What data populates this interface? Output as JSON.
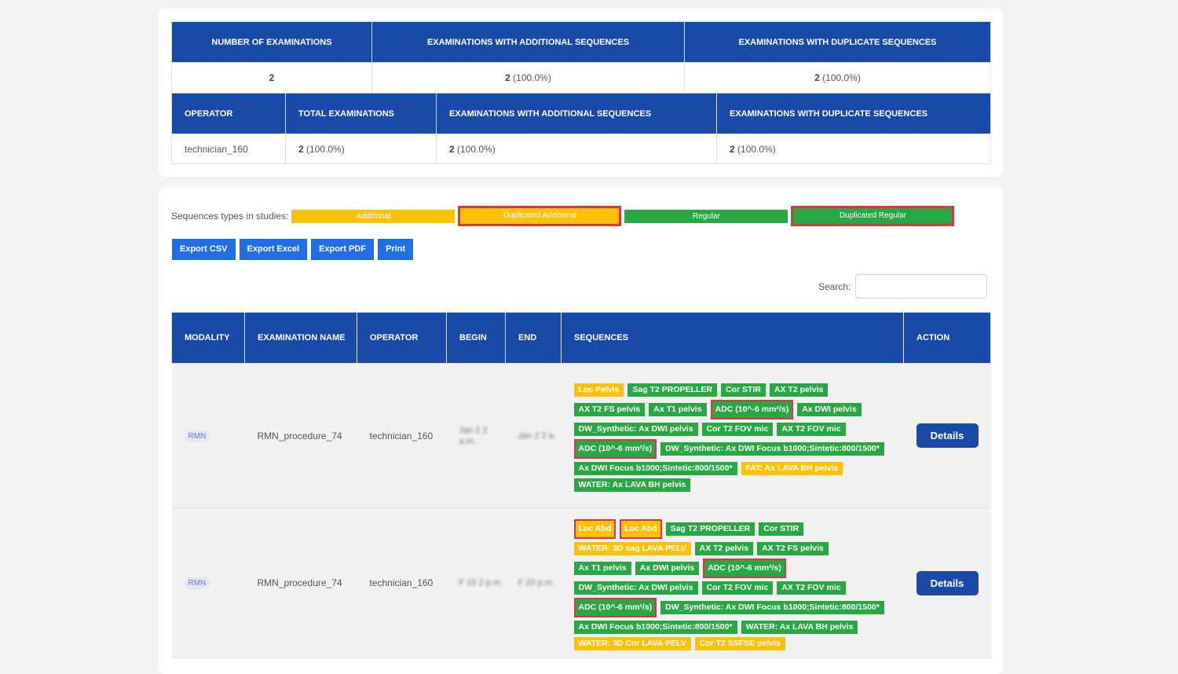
{
  "colors": {
    "header": "#1a4aa8",
    "additional": "#ffc107",
    "regular": "#28a745",
    "duplicate_border": "#dc3545",
    "button": "#1f6fe8"
  },
  "summary": {
    "headers": [
      "NUMBER OF EXAMINATIONS",
      "EXAMINATIONS WITH ADDITIONAL SEQUENCES",
      "EXAMINATIONS WITH DUPLICATE SEQUENCES"
    ],
    "count": "2",
    "additional_count": "2",
    "additional_pct": "(100.0%)",
    "duplicate_count": "2",
    "duplicate_pct": "(100.0%)"
  },
  "operator_table": {
    "headers": [
      "OPERATOR",
      "TOTAL EXAMINATIONS",
      "EXAMINATIONS WITH ADDITIONAL SEQUENCES",
      "EXAMINATIONS WITH DUPLICATE SEQUENCES"
    ],
    "row": {
      "operator": "technician_160",
      "total": "2",
      "total_pct": "(100.0%)",
      "additional": "2",
      "additional_pct": "(100.0%)",
      "duplicate": "2",
      "duplicate_pct": "(100.0%)"
    }
  },
  "legend": {
    "label": "Sequences types in studies:",
    "items": [
      "Additional",
      "Duplicated Additional",
      "Regular",
      "Duplicated Regular"
    ]
  },
  "buttons": [
    "Export CSV",
    "Export Excel",
    "Export PDF",
    "Print"
  ],
  "search": {
    "label": "Search:",
    "placeholder": ""
  },
  "data_table": {
    "headers": [
      "MODALITY",
      "EXAMINATION NAME",
      "OPERATOR",
      "BEGIN",
      "END",
      "SEQUENCES",
      "ACTION"
    ],
    "rows": [
      {
        "modality": "RMN",
        "name": "RMN_procedure_74",
        "operator": "technician_160",
        "begin": "Jan 2 2 a.m.",
        "end": "Jan 2 2 a.",
        "action": "Details",
        "sequences": [
          {
            "t": "Loc Pelvis",
            "k": "a"
          },
          {
            "t": "Sag T2 PROPELLER",
            "k": "r"
          },
          {
            "t": "Cor STIR",
            "k": "r"
          },
          {
            "t": "AX T2 pelvis",
            "k": "r"
          },
          {
            "t": "AX T2 FS pelvis",
            "k": "r"
          },
          {
            "t": "Ax T1 pelvis",
            "k": "r"
          },
          {
            "t": "ADC (10^-6 mm²/s)",
            "k": "dr"
          },
          {
            "t": "Ax DWI pelvis",
            "k": "r"
          },
          {
            "t": "DW_Synthetic: Ax DWI pelvis",
            "k": "r"
          },
          {
            "t": "Cor T2 FOV mic",
            "k": "r"
          },
          {
            "t": "AX T2 FOV mic",
            "k": "r"
          },
          {
            "t": "ADC (10^-6 mm²/s)",
            "k": "dr"
          },
          {
            "t": "DW_Synthetic: Ax DWI Focus b1000;Sintetic:800/1500*",
            "k": "r"
          },
          {
            "t": "Ax DWI Focus b1000;Sintetic:800/1500*",
            "k": "r"
          },
          {
            "t": "FAT: Ax LAVA BH pelvis",
            "k": "a"
          },
          {
            "t": "WATER: Ax LAVA BH pelvis",
            "k": "r"
          }
        ]
      },
      {
        "modality": "RMN",
        "name": "RMN_procedure_74",
        "operator": "technician_160",
        "begin": "F 15 2 p.m.",
        "end": "F 20 p.m.",
        "action": "Details",
        "sequences": [
          {
            "t": "Loc Abd",
            "k": "da"
          },
          {
            "t": "Loc Abd",
            "k": "da"
          },
          {
            "t": "Sag T2 PROPELLER",
            "k": "r"
          },
          {
            "t": "Cor STIR",
            "k": "r"
          },
          {
            "t": "WATER: 3D sag LAVA PELV",
            "k": "a"
          },
          {
            "t": "AX T2 pelvis",
            "k": "r"
          },
          {
            "t": "AX T2 FS pelvis",
            "k": "r"
          },
          {
            "t": "Ax T1 pelvis",
            "k": "r"
          },
          {
            "t": "Ax DWI pelvis",
            "k": "r"
          },
          {
            "t": "ADC (10^-6 mm²/s)",
            "k": "dr"
          },
          {
            "t": "DW_Synthetic: Ax DWI pelvis",
            "k": "r"
          },
          {
            "t": "Cor T2 FOV mic",
            "k": "r"
          },
          {
            "t": "AX T2 FOV mic",
            "k": "r"
          },
          {
            "t": "ADC (10^-6 mm²/s)",
            "k": "dr"
          },
          {
            "t": "DW_Synthetic: Ax DWI Focus b1000;Sintetic:800/1500*",
            "k": "r"
          },
          {
            "t": "Ax DWI Focus b1000;Sintetic:800/1500*",
            "k": "r"
          },
          {
            "t": "WATER: Ax LAVA BH pelvis",
            "k": "r"
          },
          {
            "t": "WATER: 3D Cor LAVA PELV",
            "k": "a"
          },
          {
            "t": "Cor T2 SSFSE pelvis",
            "k": "a"
          }
        ]
      }
    ]
  }
}
